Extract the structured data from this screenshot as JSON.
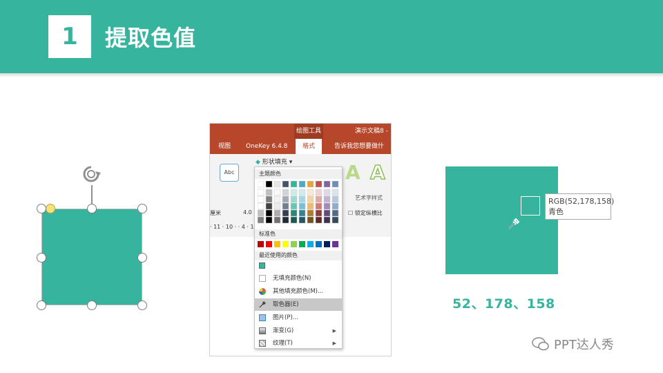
{
  "header": {
    "number": "1",
    "title": "提取色值"
  },
  "screenshot": {
    "tools_label": "绘图工具",
    "doc_label": "演示文稿8 -",
    "tabs": [
      "视图",
      "OneKey 6.4.8",
      "格式",
      "告诉我您想要做什"
    ],
    "style_preview": "Abc",
    "fill_button": "形状填充",
    "art_group": "艺术字样式",
    "lock_ratio": "锁定纵横比",
    "unit_text": "厘米",
    "size_value": "4.0",
    "ruler_text": "· 11 · 10 ·   · 4 · 1 · 5 · 1 ·",
    "menu": {
      "theme_colors_label": "主题颜色",
      "standard_colors_label": "标准色",
      "recent_colors_label": "最近使用的颜色",
      "items": [
        {
          "label": "无填充颜色(N)"
        },
        {
          "label": "其他填充颜色(M)..."
        },
        {
          "label": "取色器(E)"
        },
        {
          "label": "图片(P)..."
        },
        {
          "label": "渐变(G)"
        },
        {
          "label": "纹理(T)"
        }
      ]
    }
  },
  "picker": {
    "rgb_line": "RGB(52,178,158)",
    "name_line": "青色"
  },
  "result_text": "52、178、158",
  "watermark": "PPT达人秀",
  "colors": {
    "accent": "#36b49d",
    "ribbon": "#b7472a"
  }
}
